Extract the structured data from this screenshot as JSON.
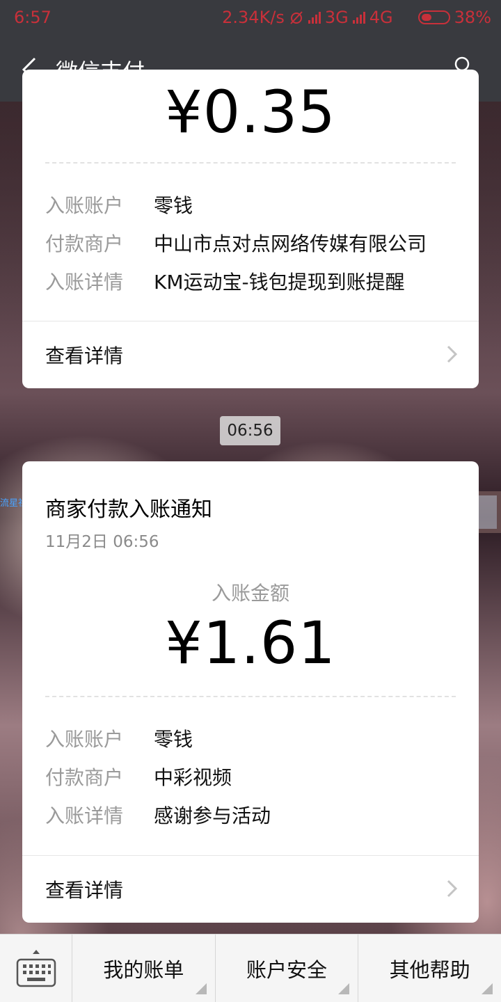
{
  "status_bar": {
    "time": "6:57",
    "net_speed": "2.34K/s",
    "net_3g": "3G",
    "net_4g": "4G",
    "battery_percent": "38%",
    "battery_level": 0.38,
    "color": "#c8303a"
  },
  "nav": {
    "title": "微信支付",
    "back_icon": "chevron-left-icon",
    "profile_icon": "person-icon"
  },
  "card1": {
    "amount": "¥0.35",
    "rows": [
      {
        "label": "入账账户",
        "value": "零钱"
      },
      {
        "label": "付款商户",
        "value": "中山市点对点网络传媒有限公司"
      },
      {
        "label": "入账详情",
        "value": "KM运动宝-钱包提现到账提醒"
      }
    ],
    "detail_link": "查看详情"
  },
  "time_divider": "06:56",
  "watermark": "流星社区",
  "card2": {
    "title": "商家付款入账通知",
    "date": "11月2日  06:56",
    "amount_label": "入账金额",
    "amount": "¥1.61",
    "rows": [
      {
        "label": "入账账户",
        "value": "零钱"
      },
      {
        "label": "付款商户",
        "value": "中彩视频"
      },
      {
        "label": "入账详情",
        "value": "感谢参与活动"
      }
    ],
    "detail_link": "查看详情"
  },
  "bottom_menu": {
    "keyboard_icon": "keyboard-icon",
    "items": [
      "我的账单",
      "账户安全",
      "其他帮助"
    ]
  }
}
